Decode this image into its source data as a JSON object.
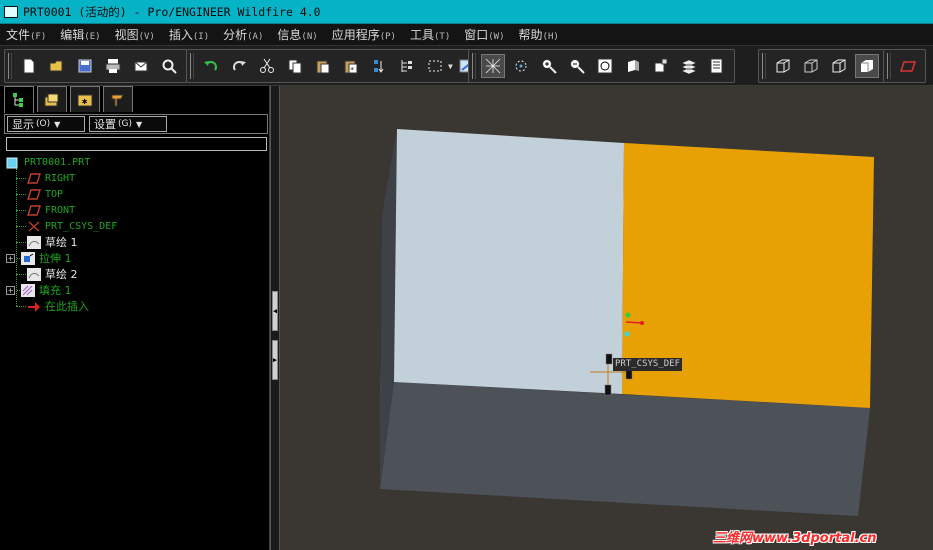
{
  "window": {
    "title": "PRT0001 (活动的) - Pro/ENGINEER Wildfire 4.0"
  },
  "menu": [
    {
      "label": "文件",
      "accel": "(F)"
    },
    {
      "label": "编辑",
      "accel": "(E)"
    },
    {
      "label": "视图",
      "accel": "(V)"
    },
    {
      "label": "插入",
      "accel": "(I)"
    },
    {
      "label": "分析",
      "accel": "(A)"
    },
    {
      "label": "信息",
      "accel": "(N)"
    },
    {
      "label": "应用程序",
      "accel": "(P)"
    },
    {
      "label": "工具",
      "accel": "(T)"
    },
    {
      "label": "窗口",
      "accel": "(W)"
    },
    {
      "label": "帮助",
      "accel": "(H)"
    }
  ],
  "toolbar": {
    "icons": [
      "new-file-icon",
      "open-folder-icon",
      "save-icon",
      "print-icon",
      "send-mail-icon",
      "search-icon",
      "undo-icon",
      "redo-icon",
      "cut-icon",
      "copy-icon",
      "paste-icon",
      "paste-special-icon",
      "regenerate-icon",
      "model-tree-icon",
      "select-box-icon",
      "repaint-icon",
      "wireframe-icon",
      "spin-center-icon",
      "zoom-in-icon",
      "zoom-out-icon",
      "refit-icon",
      "shading-icon",
      "view-manager-icon",
      "layers-icon",
      "feature-list-icon",
      "wireframe-display-icon",
      "hidden-line-icon",
      "no-hidden-icon",
      "shaded-display-icon",
      "datum-plane-icon"
    ]
  },
  "navigator": {
    "tabs": [
      "model-tree-tab",
      "folder-browser-tab",
      "favorites-tab",
      "connections-tab"
    ],
    "display_label": "显示",
    "display_accel": "(O)",
    "settings_label": "设置",
    "settings_accel": "(G)",
    "search_value": "",
    "tree": [
      {
        "label": "PRT0001.PRT",
        "icon": "part-icon",
        "depth": 0
      },
      {
        "label": "RIGHT",
        "icon": "datum-plane-icon",
        "depth": 1
      },
      {
        "label": "TOP",
        "icon": "datum-plane-icon",
        "depth": 1
      },
      {
        "label": "FRONT",
        "icon": "datum-plane-icon",
        "depth": 1
      },
      {
        "label": "PRT_CSYS_DEF",
        "icon": "csys-icon",
        "depth": 1
      },
      {
        "label": "草绘 1",
        "icon": "sketch-icon",
        "depth": 1
      },
      {
        "label": "拉伸 1",
        "icon": "extrude-icon",
        "depth": 1,
        "expandable": true
      },
      {
        "label": "草绘 2",
        "icon": "sketch-icon",
        "depth": 1
      },
      {
        "label": "填充 1",
        "icon": "fill-icon",
        "depth": 1,
        "expandable": true
      },
      {
        "label": "在此插入",
        "icon": "insert-here-icon",
        "depth": 1
      }
    ]
  },
  "viewport": {
    "csys_label": "PRT_CSYS_DEF",
    "watermark": "三维网www.3dportal.cn",
    "colors": {
      "background": "#3a3733",
      "face_light": "#c2d0da",
      "face_fill": "#e8a105",
      "side_face": "#4d5259",
      "left_face": "#3e4248"
    }
  }
}
